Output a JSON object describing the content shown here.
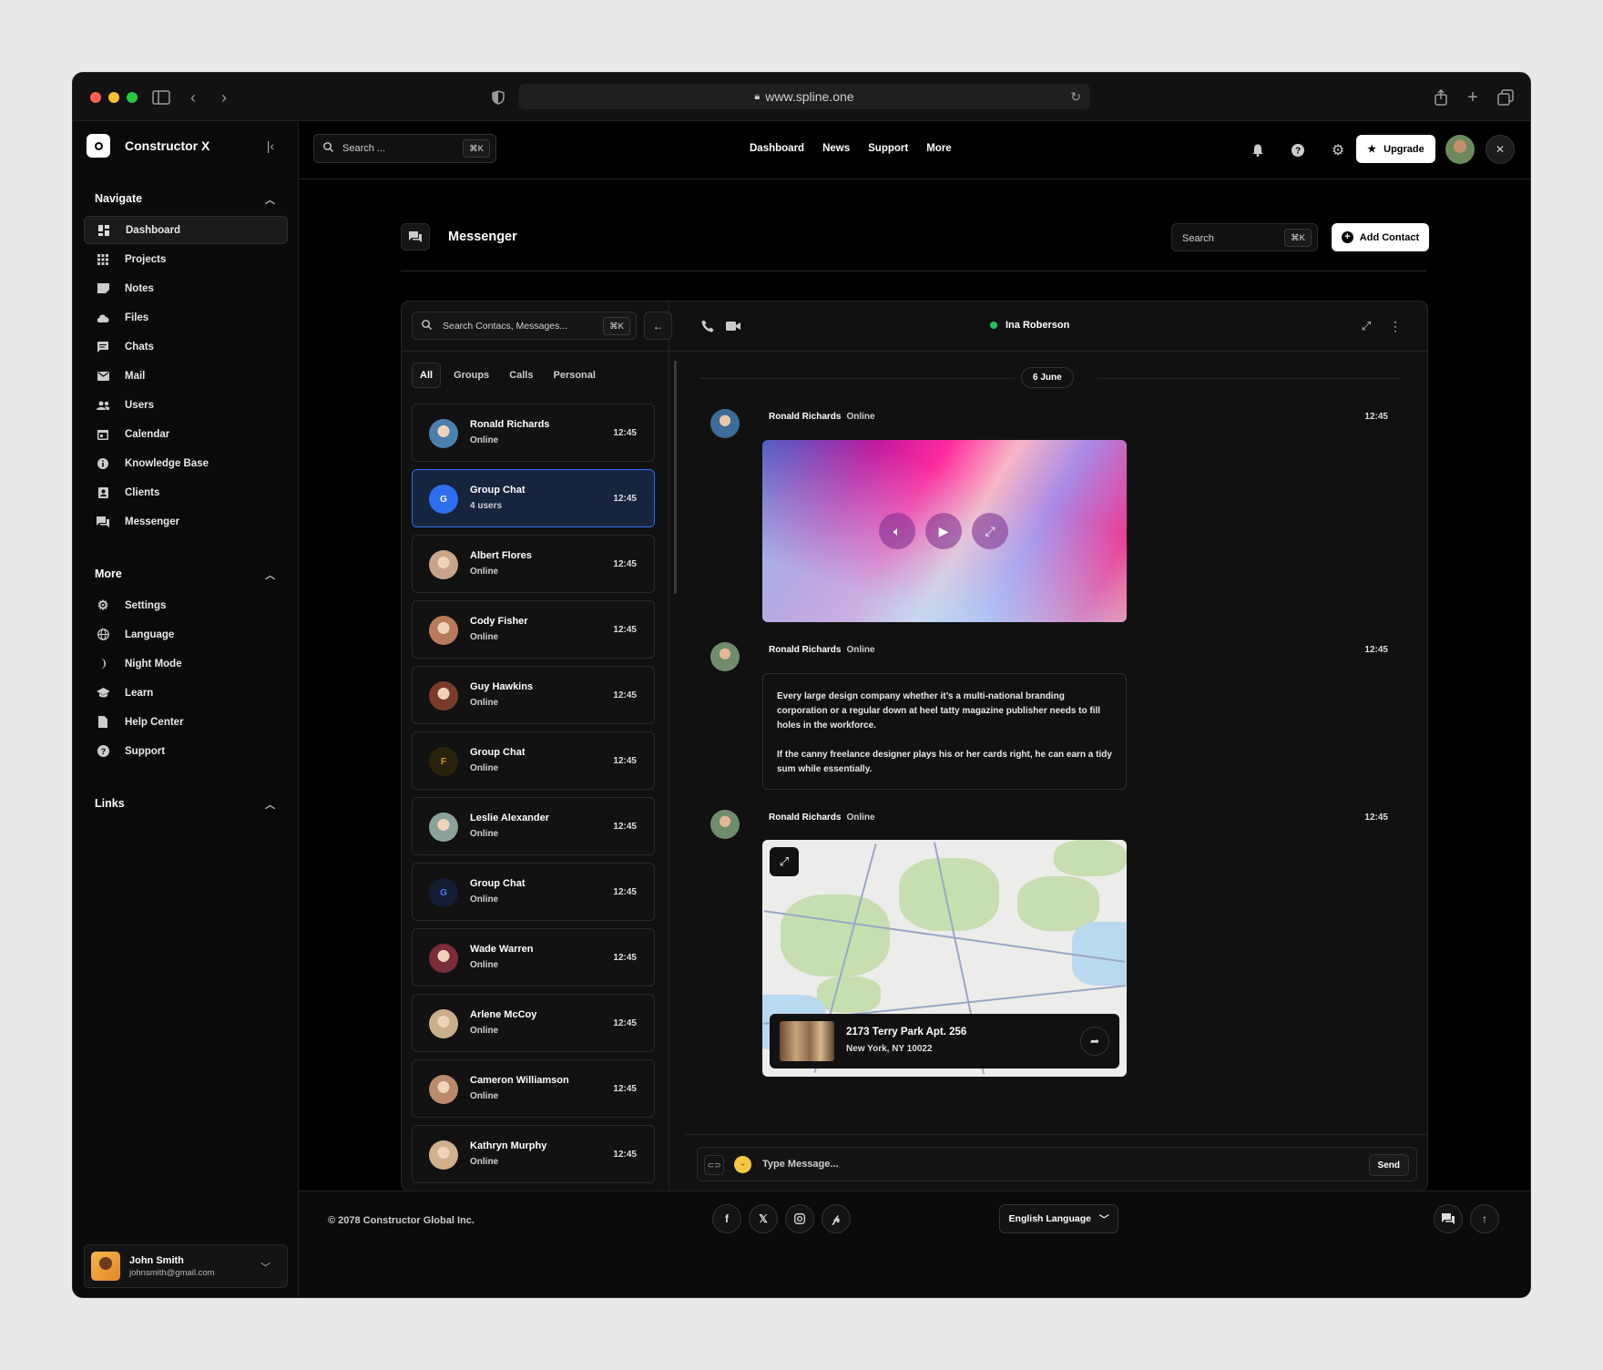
{
  "browser": {
    "url": "www.spline.one"
  },
  "sidebar": {
    "brand": "Constructor X",
    "navigate_title": "Navigate",
    "items": [
      {
        "label": "Dashboard",
        "icon": "dashboard-icon"
      },
      {
        "label": "Projects",
        "icon": "grid-icon"
      },
      {
        "label": "Notes",
        "icon": "note-icon"
      },
      {
        "label": "Files",
        "icon": "cloud-icon"
      },
      {
        "label": "Chats",
        "icon": "chat-icon"
      },
      {
        "label": "Mail",
        "icon": "mail-icon"
      },
      {
        "label": "Users",
        "icon": "users-icon"
      },
      {
        "label": "Calendar",
        "icon": "calendar-icon"
      },
      {
        "label": "Knowledge Base",
        "icon": "info-icon"
      },
      {
        "label": "Clients",
        "icon": "contact-icon"
      },
      {
        "label": "Messenger",
        "icon": "messenger-icon"
      }
    ],
    "more_title": "More",
    "more_items": [
      {
        "label": "Settings",
        "icon": "gear-icon"
      },
      {
        "label": "Language",
        "icon": "globe-icon"
      },
      {
        "label": "Night Mode",
        "icon": "moon-icon"
      },
      {
        "label": "Learn",
        "icon": "graduation-cap-icon"
      },
      {
        "label": "Help Center",
        "icon": "document-icon"
      },
      {
        "label": "Support",
        "icon": "help-icon"
      }
    ],
    "links_title": "Links",
    "user": {
      "name": "John Smith",
      "email": "johnsmith@gmail.com"
    }
  },
  "topbar": {
    "search_placeholder": "Search ...",
    "shortcut": "⌘K",
    "nav": [
      "Dashboard",
      "News",
      "Support",
      "More"
    ],
    "upgrade": "Upgrade"
  },
  "messenger": {
    "title": "Messenger",
    "search": "Search",
    "shortcut": "⌘K",
    "add_contact": "Add Contact",
    "contact_search": "Search Contacs, Messages...",
    "tabs": [
      "All",
      "Groups",
      "Calls",
      "Personal"
    ],
    "contacts": [
      {
        "name": "Ronald Richards",
        "status": "Online",
        "time": "12:45",
        "avatar": "#4a7fb0"
      },
      {
        "name": "Group Chat",
        "status": "4 users",
        "time": "12:45",
        "initial": "G",
        "avatar": "#2f6df0"
      },
      {
        "name": "Albert Flores",
        "status": "Online",
        "time": "12:45",
        "avatar": "#c8a58a"
      },
      {
        "name": "Cody Fisher",
        "status": "Online",
        "time": "12:45",
        "avatar": "#b87a5a"
      },
      {
        "name": "Guy Hawkins",
        "status": "Online",
        "time": "12:45",
        "avatar": "#7a3a2a"
      },
      {
        "name": "Group Chat",
        "status": "Online",
        "time": "12:45",
        "initial": "F",
        "avatar": "#2a220c"
      },
      {
        "name": "Leslie Alexander",
        "status": "Online",
        "time": "12:45",
        "avatar": "#8aa39a"
      },
      {
        "name": "Group Chat",
        "status": "Online",
        "time": "12:45",
        "initial": "G",
        "avatar": "#131c33"
      },
      {
        "name": "Wade Warren",
        "status": "Online",
        "time": "12:45",
        "avatar": "#7b2d3a"
      },
      {
        "name": "Arlene McCoy",
        "status": "Online",
        "time": "12:45",
        "avatar": "#c9b08a"
      },
      {
        "name": "Cameron Williamson",
        "status": "Online",
        "time": "12:45",
        "avatar": "#b98a6c"
      },
      {
        "name": "Kathryn Murphy",
        "status": "Online",
        "time": "12:45",
        "avatar": "#d1b08e"
      }
    ],
    "peer": "Ina Roberson",
    "date": "6 June",
    "messages": [
      {
        "sender": "Ronald Richards",
        "status": "Online",
        "time": "12:45"
      },
      {
        "sender": "Ronald Richards",
        "status": "Online",
        "time": "12:45",
        "p1": "Every large design company whether it’s a multi-national branding corporation or a regular down at heel tatty magazine publisher needs to fill holes in the workforce.",
        "p2": "If the canny freelance designer plays his or her cards right, he can earn a tidy sum while essentially."
      },
      {
        "sender": "Ronald Richards",
        "status": "Online",
        "time": "12:45",
        "addr1": "2173 Terry Park Apt. 256",
        "addr2": "New York, NY 10022"
      }
    ],
    "composer_placeholder": "Type Message...",
    "send": "Send"
  },
  "footer": {
    "copyright": "© 2078 Constructor Global Inc.",
    "language": "English Language"
  }
}
